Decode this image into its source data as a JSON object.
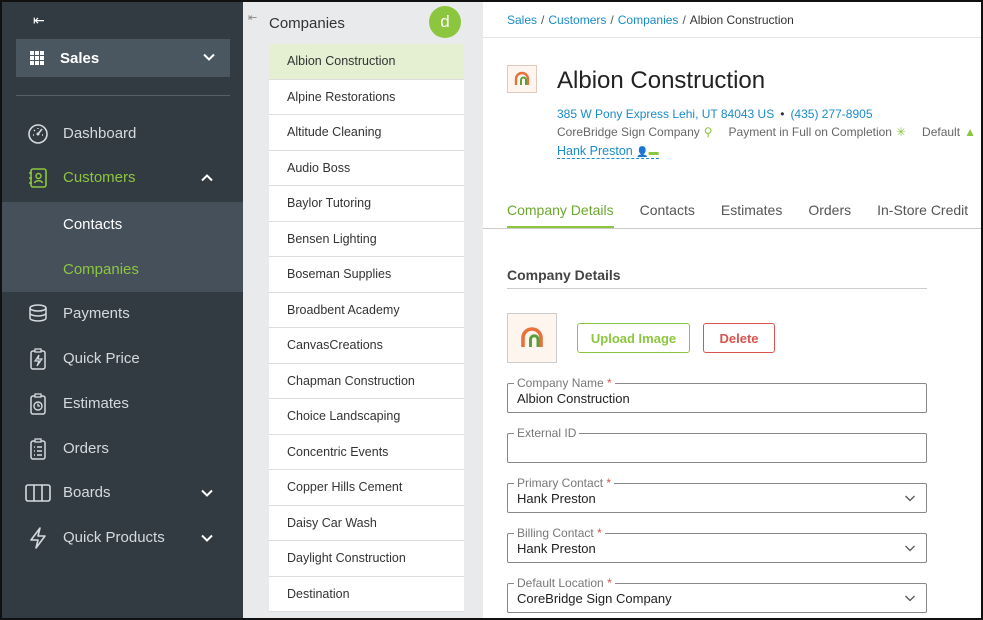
{
  "nav": {
    "collapse_glyph": "⇤",
    "module": "Sales",
    "items": [
      {
        "label": "Dashboard",
        "icon": "dashboard-icon"
      },
      {
        "label": "Customers",
        "icon": "customers-icon"
      },
      {
        "label": "Contacts"
      },
      {
        "label": "Companies"
      },
      {
        "label": "Payments",
        "icon": "payments-icon"
      },
      {
        "label": "Quick Price",
        "icon": "quick-price-icon"
      },
      {
        "label": "Estimates",
        "icon": "estimates-icon"
      },
      {
        "label": "Orders",
        "icon": "orders-icon"
      },
      {
        "label": "Boards",
        "icon": "boards-icon"
      },
      {
        "label": "Quick Products",
        "icon": "quick-products-icon"
      }
    ]
  },
  "list": {
    "back_glyph": "⇤",
    "title": "Companies",
    "avatar": "d",
    "items": [
      "Albion Construction",
      "Alpine Restorations",
      "Altitude Cleaning",
      "Audio Boss",
      "Baylor Tutoring",
      "Bensen Lighting",
      "Boseman Supplies",
      "Broadbent Academy",
      "CanvasCreations",
      "Chapman Construction",
      "Choice Landscaping",
      "Concentric Events",
      "Copper Hills Cement",
      "Daisy Car Wash",
      "Daylight Construction",
      "Destination"
    ]
  },
  "crumb": [
    "Sales",
    "Customers",
    "Companies",
    "Albion Construction"
  ],
  "crumb_sep": "/",
  "company": {
    "name": "Albion Construction",
    "address": "385 W Pony Express Lehi, UT 84043 US",
    "bullet": "•",
    "phone": "(435) 277-8905",
    "location": "CoreBridge Sign Company",
    "payment": "Payment in Full on Completion",
    "tax": "Default",
    "salesperson": "Hank Preston",
    "glyph_pin": "⚲",
    "glyph_star": "✳",
    "glyph_tri": "▲",
    "glyph_person": "👤▬"
  },
  "tabs": [
    "Company Details",
    "Contacts",
    "Estimates",
    "Orders",
    "In-Store Credit"
  ],
  "details": {
    "heading": "Company Details",
    "upload": "Upload Image",
    "delete": "Delete",
    "fields": [
      {
        "label": "Company Name",
        "req": "*",
        "value": "Albion Construction"
      },
      {
        "label": "External ID",
        "req": "",
        "value": ""
      },
      {
        "label": "Primary Contact",
        "req": "*",
        "value": "Hank Preston"
      },
      {
        "label": "Billing Contact",
        "req": "*",
        "value": "Hank Preston"
      },
      {
        "label": "Default Location",
        "req": "*",
        "value": "CoreBridge Sign Company"
      }
    ]
  },
  "colors": {
    "accent": "#8cc63f",
    "link": "#1a8bc6",
    "nav_bg": "#323b42",
    "danger": "#d9534f"
  }
}
